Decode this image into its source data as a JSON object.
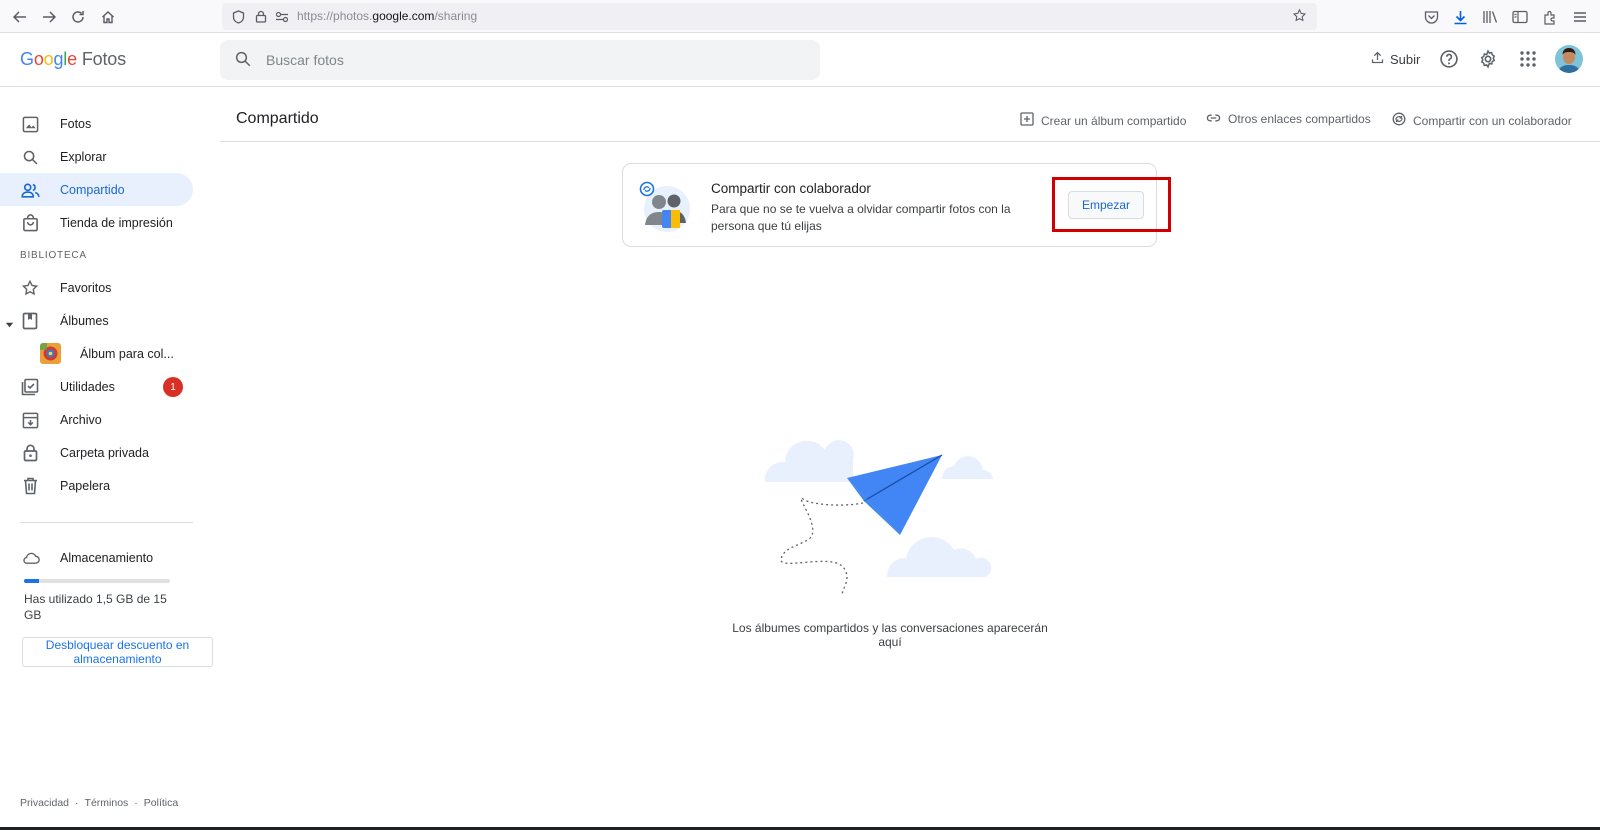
{
  "browser": {
    "url_prefix": "https://photos.",
    "url_domain": "google.com",
    "url_path": "/sharing"
  },
  "header": {
    "logo_letters": [
      "G",
      "o",
      "o",
      "g",
      "l",
      "e"
    ],
    "logo_product": "Fotos",
    "search_placeholder": "Buscar fotos",
    "upload_label": "Subir"
  },
  "sidebar": {
    "items": [
      {
        "label": "Fotos",
        "icon": "photo-icon"
      },
      {
        "label": "Explorar",
        "icon": "search-icon"
      },
      {
        "label": "Compartido",
        "icon": "people-icon",
        "active": true
      },
      {
        "label": "Tienda de impresión",
        "icon": "shopping-bag-icon"
      }
    ],
    "section_label": "BIBLIOTECA",
    "library": [
      {
        "label": "Favoritos",
        "icon": "star-icon"
      },
      {
        "label": "Álbumes",
        "icon": "album-icon"
      },
      {
        "label": "Álbum para col...",
        "icon": "album-thumbnail"
      },
      {
        "label": "Utilidades",
        "icon": "utilities-icon",
        "badge": "1"
      },
      {
        "label": "Archivo",
        "icon": "archive-icon"
      },
      {
        "label": "Carpeta privada",
        "icon": "lock-icon"
      },
      {
        "label": "Papelera",
        "icon": "trash-icon"
      }
    ],
    "storage": {
      "label": "Almacenamiento",
      "used_fraction": 0.1,
      "text": "Has utilizado 1,5 GB de 15 GB",
      "unlock_button": "Desbloquear descuento en almacenamiento"
    },
    "footer": [
      "Privacidad",
      "·",
      "Términos",
      "·",
      "Política"
    ]
  },
  "main": {
    "title": "Compartido",
    "actions": [
      {
        "label": "Crear un álbum compartido",
        "icon": "add-box-icon"
      },
      {
        "label": "Otros enlaces compartidos",
        "icon": "link-icon"
      },
      {
        "label": "Compartir con un colaborador",
        "icon": "partner-share-icon"
      }
    ],
    "promo": {
      "title": "Compartir con colaborador",
      "description": "Para que no se te vuelva a olvidar compartir fotos con la persona que tú elijas",
      "button": "Empezar"
    },
    "empty_text": "Los álbumes compartidos y las conversaciones aparecerán aquí"
  },
  "colors": {
    "accent": "#1a73e8",
    "active_bg": "#e8f0fe",
    "badge": "#d93025",
    "highlight": "#d00000"
  }
}
